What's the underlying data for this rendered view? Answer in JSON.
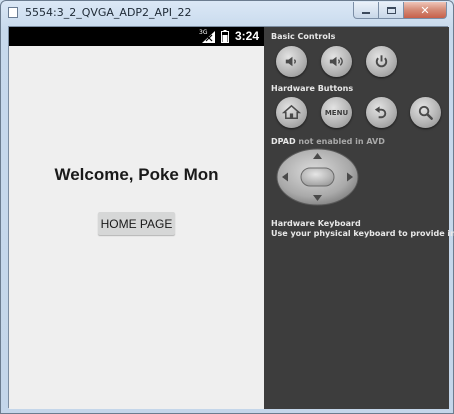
{
  "window": {
    "title": "5554:3_2_QVGA_ADP2_API_22",
    "minimize_glyph": "",
    "close_glyph": "✕"
  },
  "statusbar": {
    "network": "3G",
    "time": "3:24"
  },
  "app": {
    "welcome_text": "Welcome, Poke Mon",
    "home_button_label": "HOME PAGE"
  },
  "panel": {
    "basic_controls_label": "Basic Controls",
    "hardware_buttons_label": "Hardware Buttons",
    "menu_label": "MENU",
    "dpad_label": "DPAD",
    "dpad_note": "not enabled in AVD",
    "keyboard_title": "Hardware Keyboard",
    "keyboard_hint": "Use your physical keyboard to provide input",
    "basic_controls": [
      "volume-down-icon",
      "volume-up-icon",
      "power-icon"
    ],
    "hardware_buttons": [
      "home-icon",
      "menu",
      "back-icon",
      "search-icon"
    ]
  },
  "colors": {
    "panel_bg": "#3d3d3d",
    "phone_bg": "#efefef",
    "statusbar_bg": "#000000",
    "button_bg": "#d6d7d7"
  }
}
